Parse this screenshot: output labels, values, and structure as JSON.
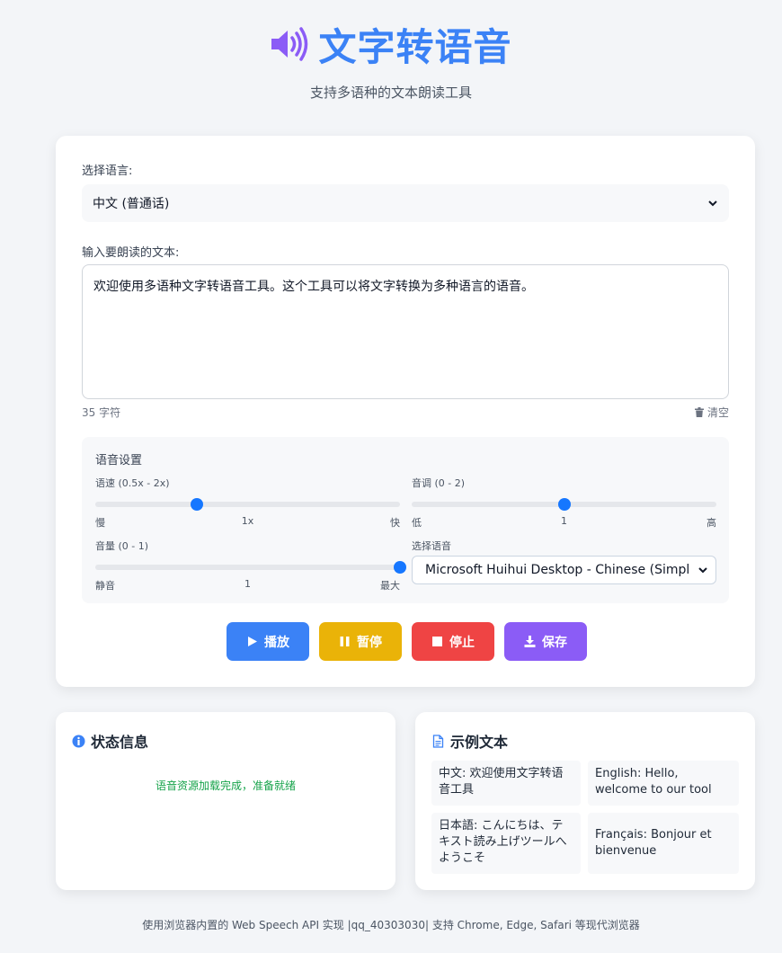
{
  "header": {
    "title": "文字转语音",
    "subtitle": "支持多语种的文本朗读工具"
  },
  "language": {
    "label": "选择语言:",
    "selected": "中文 (普通话)"
  },
  "text_input": {
    "label": "输入要朗读的文本:",
    "value": "欢迎使用多语种文字转语音工具。这个工具可以将文字转换为多种语言的语音。",
    "char_count": "35 字符",
    "clear_label": "清空"
  },
  "settings": {
    "title": "语音设置",
    "rate": {
      "label": "语速 (0.5x - 2x)",
      "value": 1,
      "min": 0.5,
      "max": 2,
      "ticks": [
        "慢",
        "1x",
        "快"
      ]
    },
    "pitch": {
      "label": "音调 (0 - 2)",
      "value": 1,
      "min": 0,
      "max": 2,
      "ticks": [
        "低",
        "1",
        "高"
      ]
    },
    "volume": {
      "label": "音量 (0 - 1)",
      "value": 1,
      "min": 0,
      "max": 1,
      "ticks": [
        "静音",
        "1",
        "最大"
      ]
    },
    "voice": {
      "label": "选择语音",
      "selected": "Microsoft Huihui Desktop - Chinese (Simplified) ("
    }
  },
  "buttons": {
    "play": "播放",
    "pause": "暂停",
    "stop": "停止",
    "save": "保存"
  },
  "status": {
    "title": "状态信息",
    "message": "语音资源加载完成，准备就绪"
  },
  "samples": {
    "title": "示例文本",
    "items": [
      "中文: 欢迎使用文字转语音工具",
      "English: Hello, welcome to our tool",
      "日本語: こんにちは、テキスト読み上げツールへようこそ",
      "Français: Bonjour et bienvenue"
    ]
  },
  "footer": "使用浏览器内置的 Web Speech API 实现 |qq_40303030| 支持 Chrome, Edge, Safari 等现代浏览器",
  "colors": {
    "accent": "#3b82f6",
    "speaker_icon": "#8b5cf6",
    "play": "#3b82f6",
    "pause": "#eab308",
    "stop": "#ef4444",
    "save": "#8b5cf6",
    "slider_thumb": "#1677ff",
    "status_ok": "#16a34a"
  },
  "icons": {
    "title": "volume-up-icon",
    "clear": "trash-icon",
    "play": "play-icon",
    "pause": "pause-icon",
    "stop": "stop-icon",
    "save": "download-icon",
    "status": "info-icon",
    "samples": "file-text-icon"
  }
}
